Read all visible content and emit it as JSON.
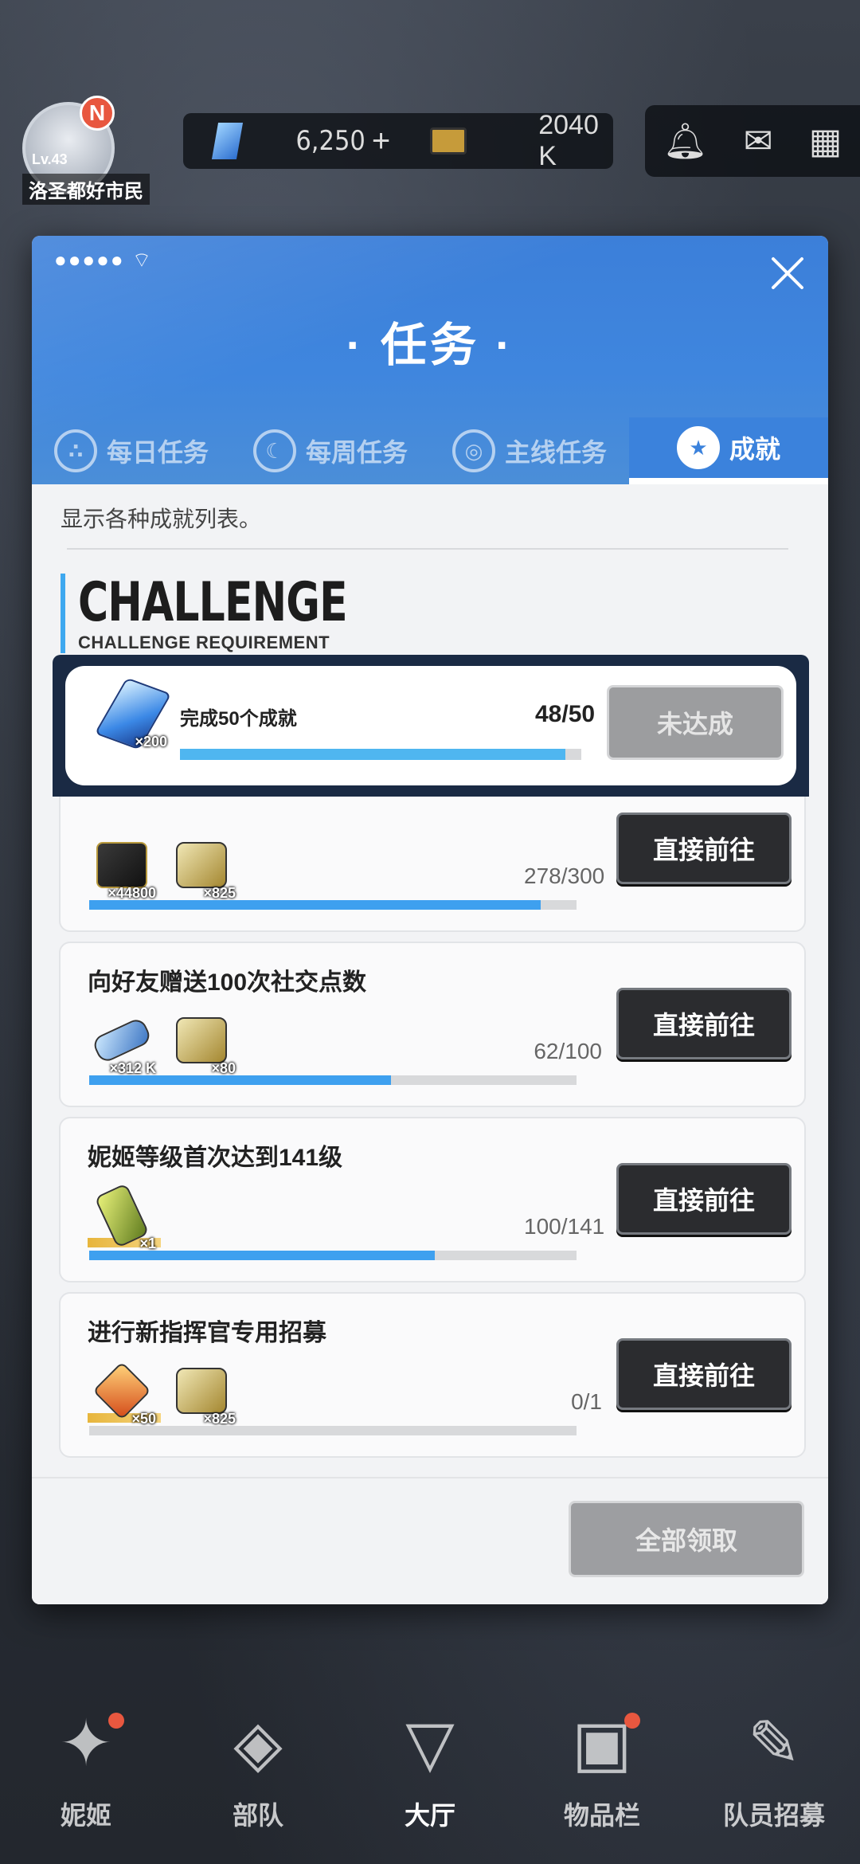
{
  "topbar": {
    "player_level": "Lv.43",
    "player_name": "洛圣都好市民",
    "avatar_badge": "N",
    "gems": "6,250",
    "gems_plus": "+",
    "credits": "2040 K"
  },
  "modal": {
    "title": "· 任务 ·",
    "signal": "●●●●● ⌔",
    "tabs": [
      {
        "label": "每日任务",
        "icon": "dots-icon"
      },
      {
        "label": "每周任务",
        "icon": "moon-icon"
      },
      {
        "label": "主线任务",
        "icon": "globe-icon"
      },
      {
        "label": "成就",
        "icon": "star-icon"
      }
    ],
    "description": "显示各种成就列表。",
    "section_title": "CHALLENGE",
    "section_subtitle": "CHALLENGE REQUIREMENT",
    "featured": {
      "title": "完成50个成就",
      "progress": "48/50",
      "progress_value": 0.96,
      "reward_qty": "×200",
      "button": "未达成"
    },
    "cards": [
      {
        "title": "",
        "rewards": [
          {
            "type": "credit",
            "qty": "×44800"
          },
          {
            "type": "gold",
            "qty": "×825"
          }
        ],
        "progress": "278/300",
        "progress_value": 0.927,
        "button": "直接前往"
      },
      {
        "title": "向好友赠送100次社交点数",
        "rewards": [
          {
            "type": "usb",
            "qty": "×312 K"
          },
          {
            "type": "gold",
            "qty": "×80"
          }
        ],
        "progress": "62/100",
        "progress_value": 0.62,
        "button": "直接前往"
      },
      {
        "title": "妮姬等级首次达到141级",
        "rewards": [
          {
            "type": "battery",
            "qty": "×1"
          }
        ],
        "progress": "100/141",
        "progress_value": 0.709,
        "button": "直接前往"
      },
      {
        "title": "进行新指挥官专用招募",
        "rewards": [
          {
            "type": "ticket",
            "qty": "×50"
          },
          {
            "type": "gold",
            "qty": "×825"
          }
        ],
        "progress": "0/1",
        "progress_value": 0.0,
        "button": "直接前往"
      }
    ],
    "claim_all": "全部领取"
  },
  "bottom_nav": [
    {
      "label": "妮姬",
      "icon": "nikke-icon"
    },
    {
      "label": "部队",
      "icon": "squad-icon"
    },
    {
      "label": "大厅",
      "icon": "lobby-icon"
    },
    {
      "label": "物品栏",
      "icon": "inventory-icon"
    },
    {
      "label": "队员招募",
      "icon": "recruit-icon"
    }
  ],
  "colors": {
    "accent_blue": "#3ea0ef",
    "header_blue": "#3f86de",
    "dark_button": "#2b2c2f",
    "disabled_button": "#9c9d9f"
  }
}
